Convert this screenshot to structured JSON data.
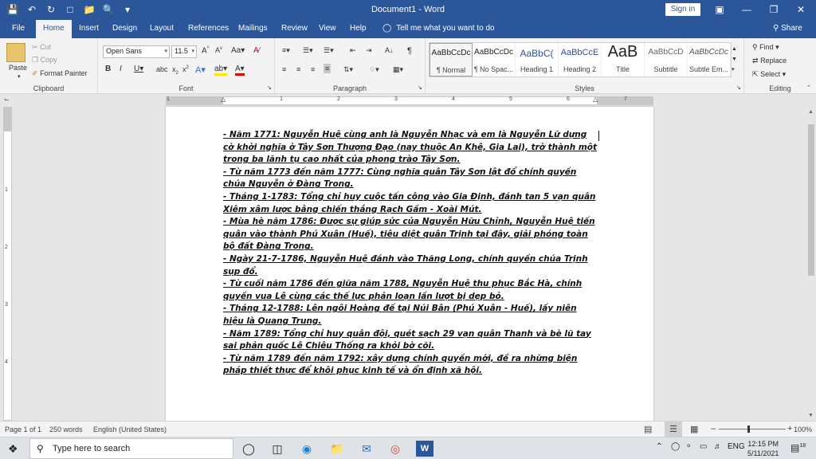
{
  "window": {
    "title": "Document1 - Word",
    "signin": "Sign in"
  },
  "tabs": [
    "File",
    "Home",
    "Insert",
    "Design",
    "Layout",
    "References",
    "Mailings",
    "Review",
    "View",
    "Help"
  ],
  "tellme": "Tell me what you want to do",
  "share": "Share",
  "clipboard": {
    "paste": "Paste",
    "cut": "Cut",
    "copy": "Copy",
    "format_painter": "Format Painter",
    "label": "Clipboard"
  },
  "font": {
    "name": "Open Sans",
    "size": "11.5",
    "label": "Font"
  },
  "paragraph": {
    "label": "Paragraph"
  },
  "styles": {
    "label": "Styles",
    "items": [
      {
        "preview": "AaBbCcDc",
        "name": "¶ Normal"
      },
      {
        "preview": "AaBbCcDc",
        "name": "¶ No Spac..."
      },
      {
        "preview": "AaBbC(",
        "name": "Heading 1"
      },
      {
        "preview": "AaBbCcE",
        "name": "Heading 2"
      },
      {
        "preview": "AaB",
        "name": "Title"
      },
      {
        "preview": "AaBbCcD",
        "name": "Subtitle"
      },
      {
        "preview": "AaBbCcDc",
        "name": "Subtle Em..."
      }
    ]
  },
  "editing": {
    "find": "Find",
    "replace": "Replace",
    "select": "Select",
    "label": "Editing"
  },
  "ruler_numbers": [
    "1",
    "1",
    "2",
    "3",
    "4",
    "5",
    "6",
    "7"
  ],
  "document": {
    "paragraphs": [
      "- Năm 1771: Nguyễn Huệ cùng anh là Nguyễn Nhạc và em là Nguyễn Lữ dựng cờ khởi nghĩa ở Tây Sơn Thượng Đạo (nay thuộc An Khê, Gia Lai), trở thành một trong ba lãnh tụ cao nhất của phong trào Tây Sơn.",
      "- Từ năm 1773 đến năm 1777: Cùng nghĩa quân Tây Sơn lật đổ chính quyền chúa Nguyễn ở Đàng Trong.",
      "- Tháng 1-1783: Tổng chỉ huy cuộc tấn công vào Gia Định, đánh tan 5 vạn quân Xiêm xâm lược bằng chiến thắng Rạch Gầm - Xoài Mút.",
      "- Mùa hè năm 1786: Được sự giúp sức của Nguyễn Hữu Chỉnh, Nguyễn Huệ tiến quân vào thành Phú Xuân (Huế), tiêu diệt quân Trịnh tại đây, giải phóng toàn bộ đất Đàng Trong.",
      "- Ngày 21-7-1786, Nguyễn Huệ đánh vào Thăng Long, chính quyền chúa Trịnh sụp đổ.",
      "- Từ cuối năm 1786 đến giữa năm 1788, Nguyễn Huệ thu phục Bắc Hà, chính quyền vua Lê cùng các thế lực phản loạn lần lượt bị dẹp bỏ.",
      "- Tháng 12-1788: Lên ngôi Hoàng đế tại Núi Bân (Phú Xuân - Huế), lấy niên hiệu là Quang Trung.",
      "- Năm 1789: Tổng chỉ huy quân đội, quét sạch 29 vạn quân Thanh và bè lũ tay sai phản quốc Lê Chiêu Thống ra khỏi bờ cõi.",
      "- Từ năm 1789 đến năm 1792: xây dựng chính quyền mới, đề ra những biện pháp thiết thực để khôi phục kinh tế và ổn định xã hội."
    ]
  },
  "status": {
    "page": "Page 1 of 1",
    "words": "250 words",
    "language": "English (United States)",
    "zoom": "100%",
    "zoom_level": 1.0
  },
  "taskbar": {
    "search_placeholder": "Type here to search",
    "lang": "ENG",
    "time": "12:15 PM",
    "date": "5/11/2021",
    "notifications": "18"
  },
  "colors": {
    "accent": "#2b579a"
  }
}
